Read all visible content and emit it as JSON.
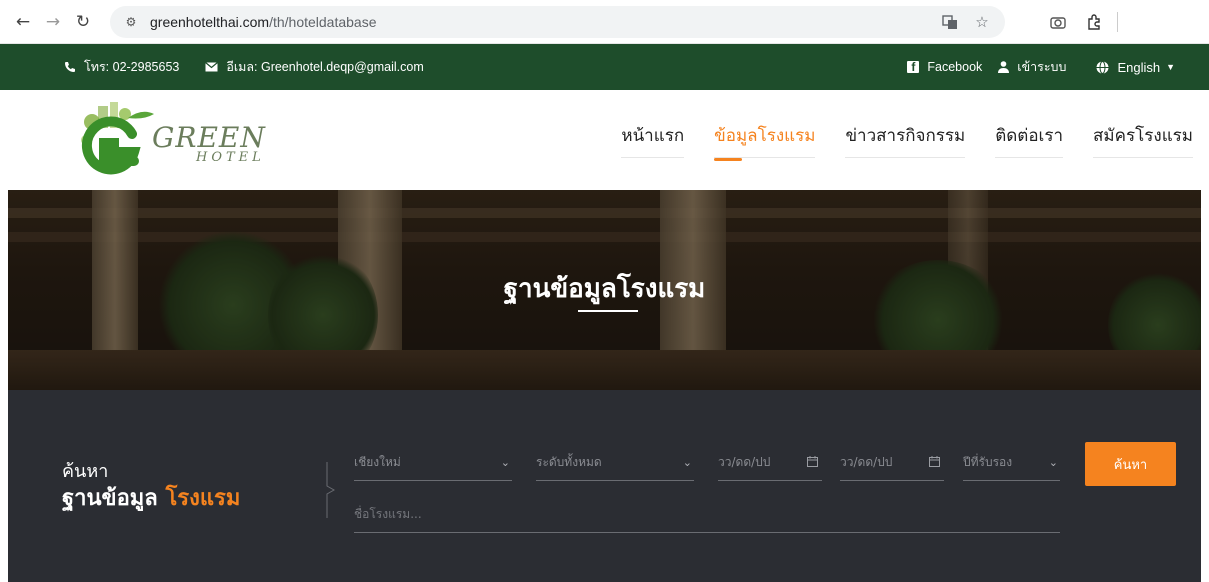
{
  "browser": {
    "url_domain": "greenhotelthai.com",
    "url_path": "/th/hoteldatabase"
  },
  "topbar": {
    "phone": "โทร: 02-2985653",
    "email": "อีเมล: Greenhotel.deqp@gmail.com",
    "facebook": "Facebook",
    "login": "เข้าระบบ",
    "language": "English"
  },
  "logo": {
    "line1": "GREEN",
    "line2": "HOTEL"
  },
  "menu": {
    "items": [
      {
        "label": "หน้าแรก",
        "active": false
      },
      {
        "label": "ข้อมูลโรงแรม",
        "active": true
      },
      {
        "label": "ข่าวสารกิจกรรม",
        "active": false
      },
      {
        "label": "ติดต่อเรา",
        "active": false
      },
      {
        "label": "สมัครโรงแรม",
        "active": false
      }
    ]
  },
  "hero": {
    "title": "ฐานข้อมูลโรงแรม"
  },
  "search": {
    "label_small": "ค้นหา",
    "label_big": "ฐานข้อมูล",
    "label_highlight": "โรงแรม",
    "province": "เชียงใหม่",
    "level": "ระดับทั้งหมด",
    "date_from_placeholder": "วว/ดด/ปป",
    "date_to_placeholder": "วว/ดด/ปป",
    "year": "ปีที่รับรอง",
    "hotel_name_placeholder": "ชื่อโรงแรม...",
    "button": "ค้นหา"
  },
  "colors": {
    "topbar_green": "#1e4d2b",
    "accent_orange": "#f5831f",
    "search_bg": "#2b2d33"
  }
}
